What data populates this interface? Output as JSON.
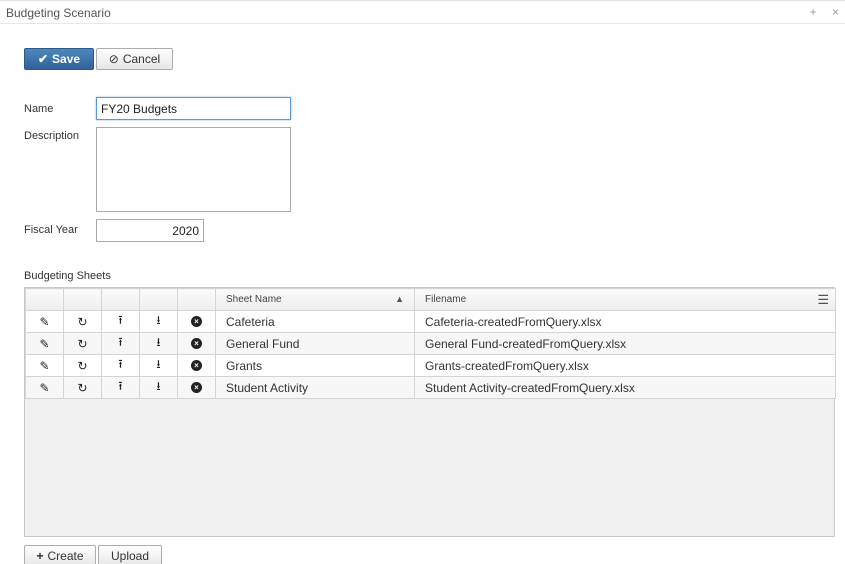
{
  "panel": {
    "title": "Budgeting Scenario",
    "tools": "+ ×"
  },
  "toolbar": {
    "save_label": "Save",
    "cancel_label": "Cancel"
  },
  "form": {
    "name_label": "Name",
    "name_value": "FY20 Budgets",
    "description_label": "Description",
    "description_value": "",
    "fiscal_year_label": "Fiscal Year",
    "fiscal_year_value": "2020"
  },
  "sheets": {
    "title": "Budgeting Sheets",
    "columns": {
      "sheet_name": "Sheet Name",
      "filename": "Filename"
    },
    "rows": [
      {
        "sheet_name": "Cafeteria",
        "filename": "Cafeteria-createdFromQuery.xlsx"
      },
      {
        "sheet_name": "General Fund",
        "filename": "General Fund-createdFromQuery.xlsx"
      },
      {
        "sheet_name": "Grants",
        "filename": "Grants-createdFromQuery.xlsx"
      },
      {
        "sheet_name": "Student Activity",
        "filename": "Student Activity-createdFromQuery.xlsx"
      }
    ],
    "row_actions": [
      "edit-icon",
      "refresh-icon",
      "upload-icon",
      "download-icon",
      "remove-icon"
    ]
  },
  "bottom_toolbar": {
    "create_label": "Create",
    "upload_label": "Upload"
  }
}
